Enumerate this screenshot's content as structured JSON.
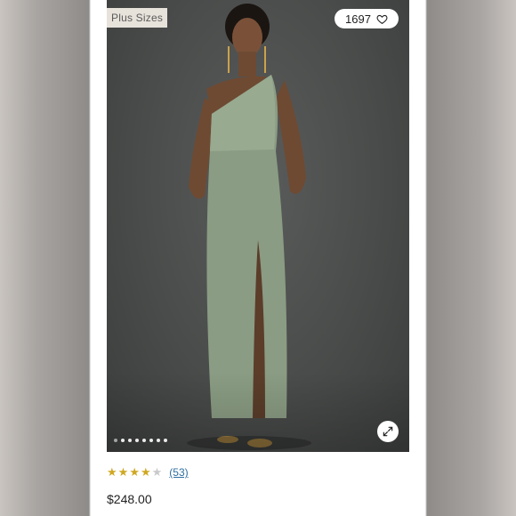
{
  "badge": {
    "label": "Plus Sizes"
  },
  "favorites": {
    "count": "1697",
    "icon": "heart-icon"
  },
  "carousel": {
    "slide_count": 8,
    "active_index": 0
  },
  "rating": {
    "value": 4,
    "max": 5,
    "review_count_label": "(53)"
  },
  "price": "$248.00",
  "colors": {
    "star": "#cfa823",
    "star_off": "#c9c9c9",
    "link": "#2f6f9f",
    "badge_bg": "#e7e2da"
  }
}
